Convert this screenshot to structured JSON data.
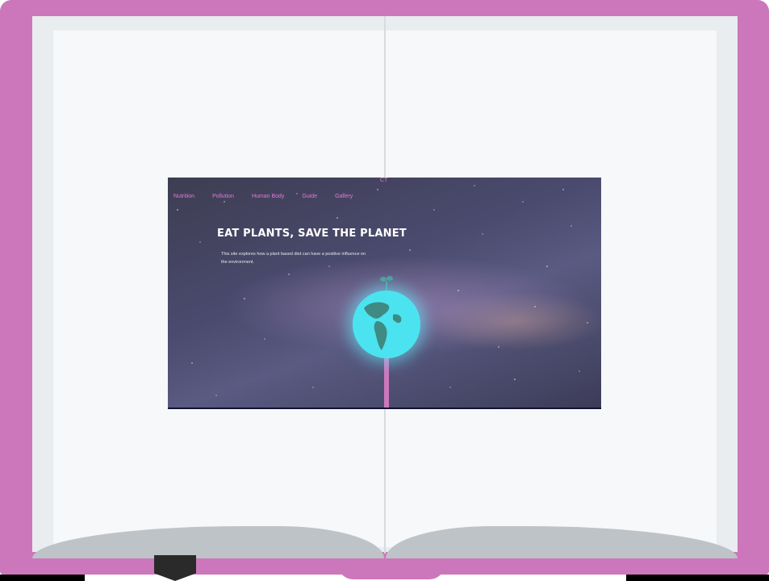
{
  "colors": {
    "cover": "#cc77bb",
    "page": "#f6f8f9",
    "nav_link": "#e07ad8",
    "globe": "#4be3f0",
    "headline": "#ffffff"
  },
  "site": {
    "logo_text": "CT",
    "nav": [
      "Nutrition",
      "Pollution",
      "Human Body",
      "Guide",
      "Gallery"
    ],
    "headline": "EAT PLANTS, SAVE THE PLANET",
    "subtext": "This site explores how a plant based diet can have a positive influence on the environment."
  },
  "icons": {
    "globe": "earth-globe-icon",
    "fork": "fork-icon",
    "sprout": "sprout-icon",
    "bookmark": "bookmark-icon"
  }
}
